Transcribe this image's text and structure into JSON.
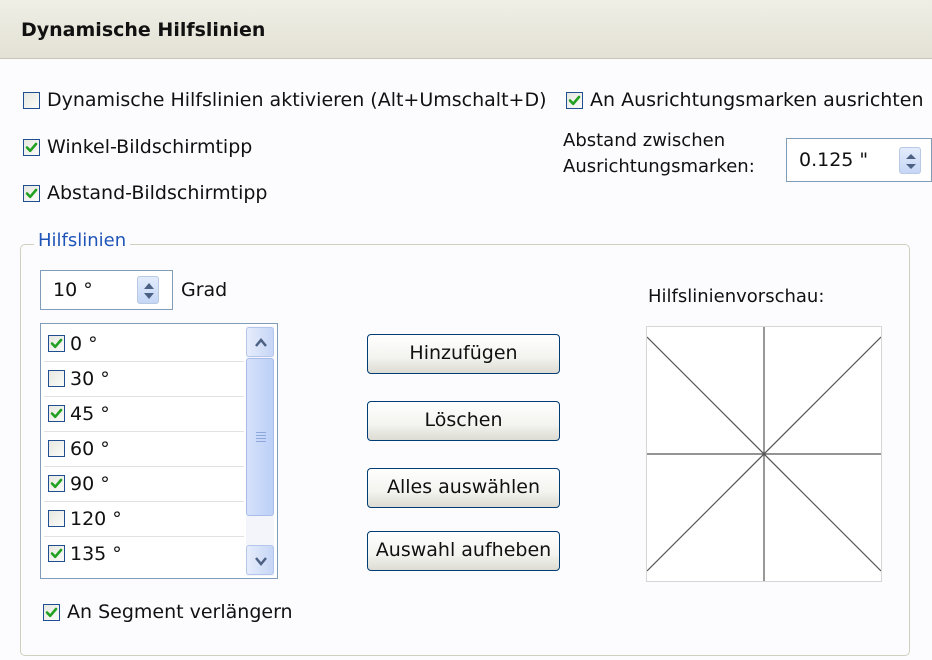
{
  "header": {
    "title": "Dynamische Hilfslinien"
  },
  "options": {
    "enable_dynamic_guides": {
      "label": "Dynamische Hilfslinien aktivieren (Alt+Umschalt+D)",
      "checked": false
    },
    "angle_tooltip": {
      "label": "Winkel-Bildschirmtipp",
      "checked": true
    },
    "distance_tooltip": {
      "label": "Abstand-Bildschirmtipp",
      "checked": true
    },
    "snap_to_ticks": {
      "label": "An Ausrichtungsmarken ausrichten",
      "checked": true
    }
  },
  "tick_spacing": {
    "label_line1": "Abstand zwischen",
    "label_line2": "Ausrichtungsmarken:",
    "value": "0.125 \""
  },
  "guides": {
    "legend": "Hilfslinien",
    "angle_value": "10 °",
    "angle_unit": "Grad",
    "list": [
      {
        "label": "0 °",
        "checked": true
      },
      {
        "label": "30 °",
        "checked": false
      },
      {
        "label": "45 °",
        "checked": true
      },
      {
        "label": "60 °",
        "checked": false
      },
      {
        "label": "90 °",
        "checked": true
      },
      {
        "label": "120 °",
        "checked": false
      },
      {
        "label": "135 °",
        "checked": true
      }
    ],
    "buttons": {
      "add": "Hinzufügen",
      "delete": "Löschen",
      "select_all": "Alles auswählen",
      "deselect": "Auswahl aufheben"
    },
    "extend_to_segment": {
      "label": "An Segment verlängern",
      "checked": true
    },
    "preview_label": "Hilfslinienvorschau:"
  },
  "colors": {
    "check": "#21a121",
    "accent": "#1f55b8",
    "border": "#1f4f91"
  },
  "icons": {
    "spin": "spin-arrows-icon",
    "scroll_up": "chevron-up-icon",
    "scroll_down": "chevron-down-icon"
  }
}
